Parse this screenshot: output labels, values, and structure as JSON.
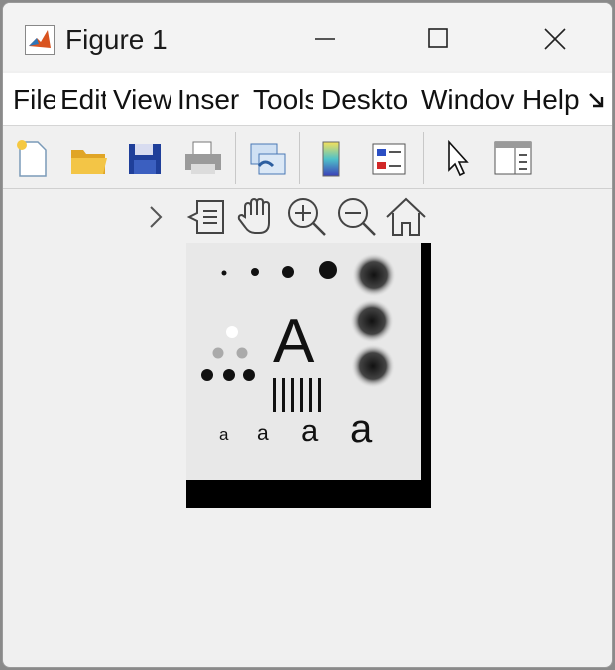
{
  "window": {
    "title": "Figure 1"
  },
  "menubar": {
    "items": [
      "File",
      "Edit",
      "View",
      "Inser",
      "Tools",
      "Deskto",
      "Windov",
      "Help"
    ]
  },
  "image": {
    "big_letter": "A",
    "small_letter": "a"
  },
  "icons": {
    "app": "matlab-icon",
    "toolbar": [
      "new-figure-icon",
      "open-file-icon",
      "save-icon",
      "print-icon",
      "link-icon",
      "colorbar-icon",
      "legend-icon",
      "select-arrow-icon",
      "property-inspector-icon"
    ],
    "axes": [
      "expand-chevron-icon",
      "data-tips-icon",
      "pan-hand-icon",
      "zoom-in-icon",
      "zoom-out-icon",
      "home-icon"
    ]
  }
}
